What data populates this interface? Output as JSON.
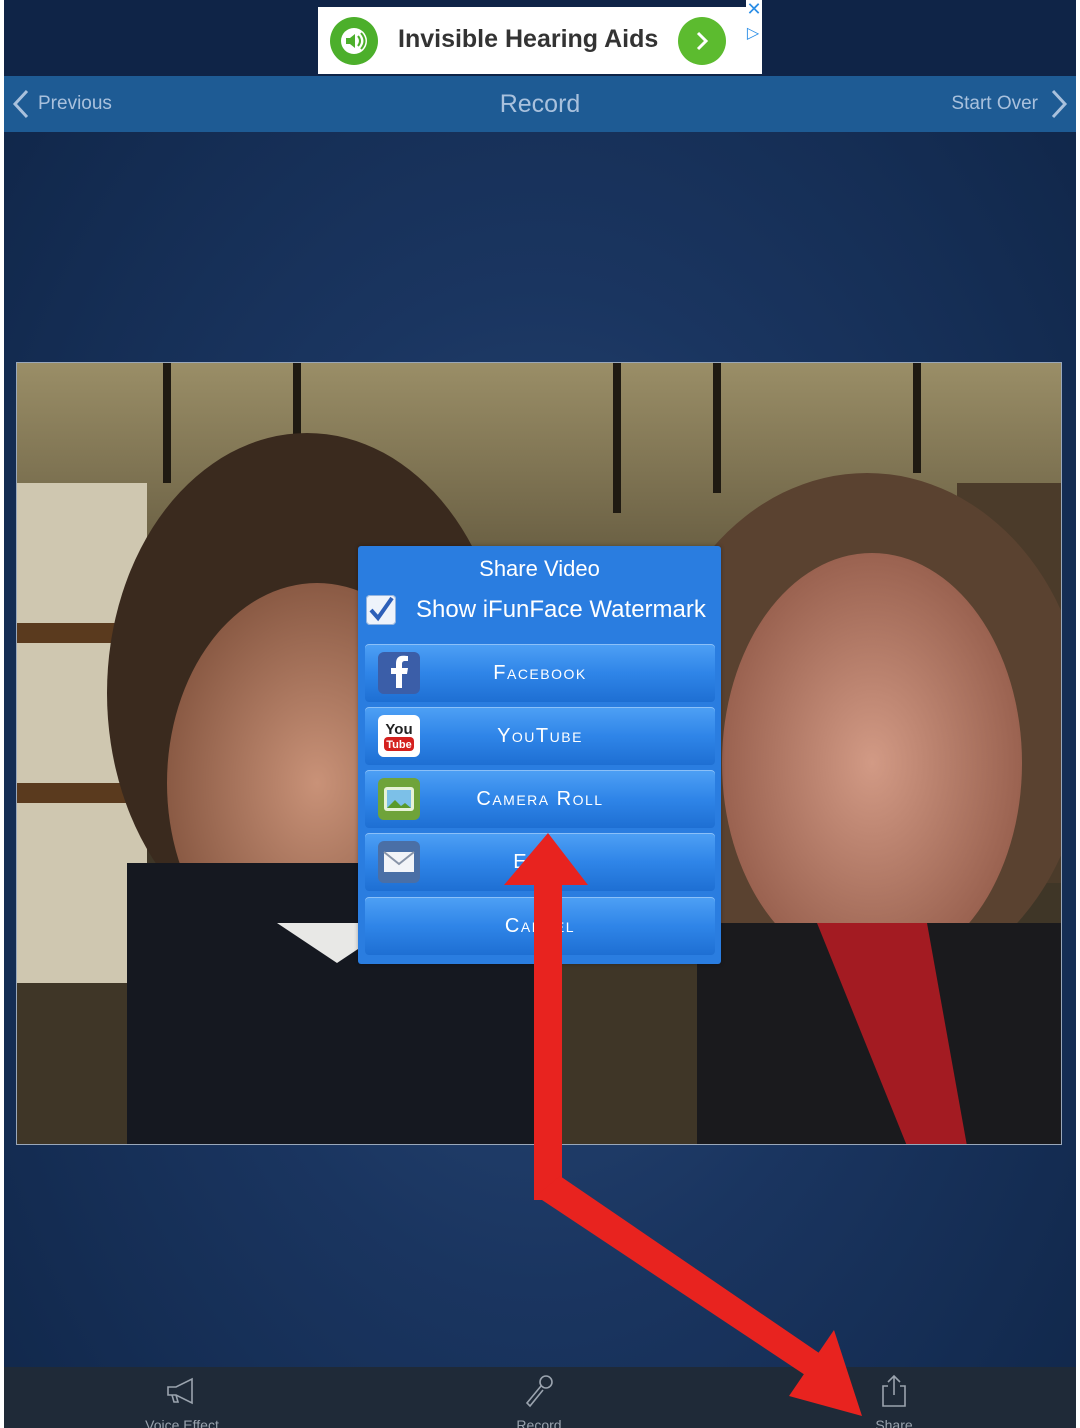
{
  "ad": {
    "title": "Invisible Hearing Aids",
    "close_glyph": "✕",
    "adchoices_glyph": "▷",
    "accent": "#4caf2b"
  },
  "navbar": {
    "previous_label": "Previous",
    "title": "Record",
    "start_over_label": "Start Over",
    "color": "#1e5b94"
  },
  "share_dialog": {
    "title": "Share Video",
    "watermark_label": "Show iFunFace Watermark",
    "watermark_checked": true,
    "buttons": [
      {
        "label": "Facebook",
        "icon": "facebook-icon"
      },
      {
        "label": "YouTube",
        "icon": "youtube-icon"
      },
      {
        "label": "Camera Roll",
        "icon": "camera-roll-icon"
      },
      {
        "label": "Email",
        "icon": "email-icon"
      },
      {
        "label": "Cancel",
        "icon": ""
      }
    ]
  },
  "tabbar": {
    "tabs": [
      {
        "label": "Voice Effect",
        "icon": "megaphone-icon"
      },
      {
        "label": "Record",
        "icon": "microphone-icon"
      },
      {
        "label": "Share",
        "icon": "share-icon"
      }
    ]
  },
  "annotation": {
    "arrow_color": "#e8231f"
  }
}
